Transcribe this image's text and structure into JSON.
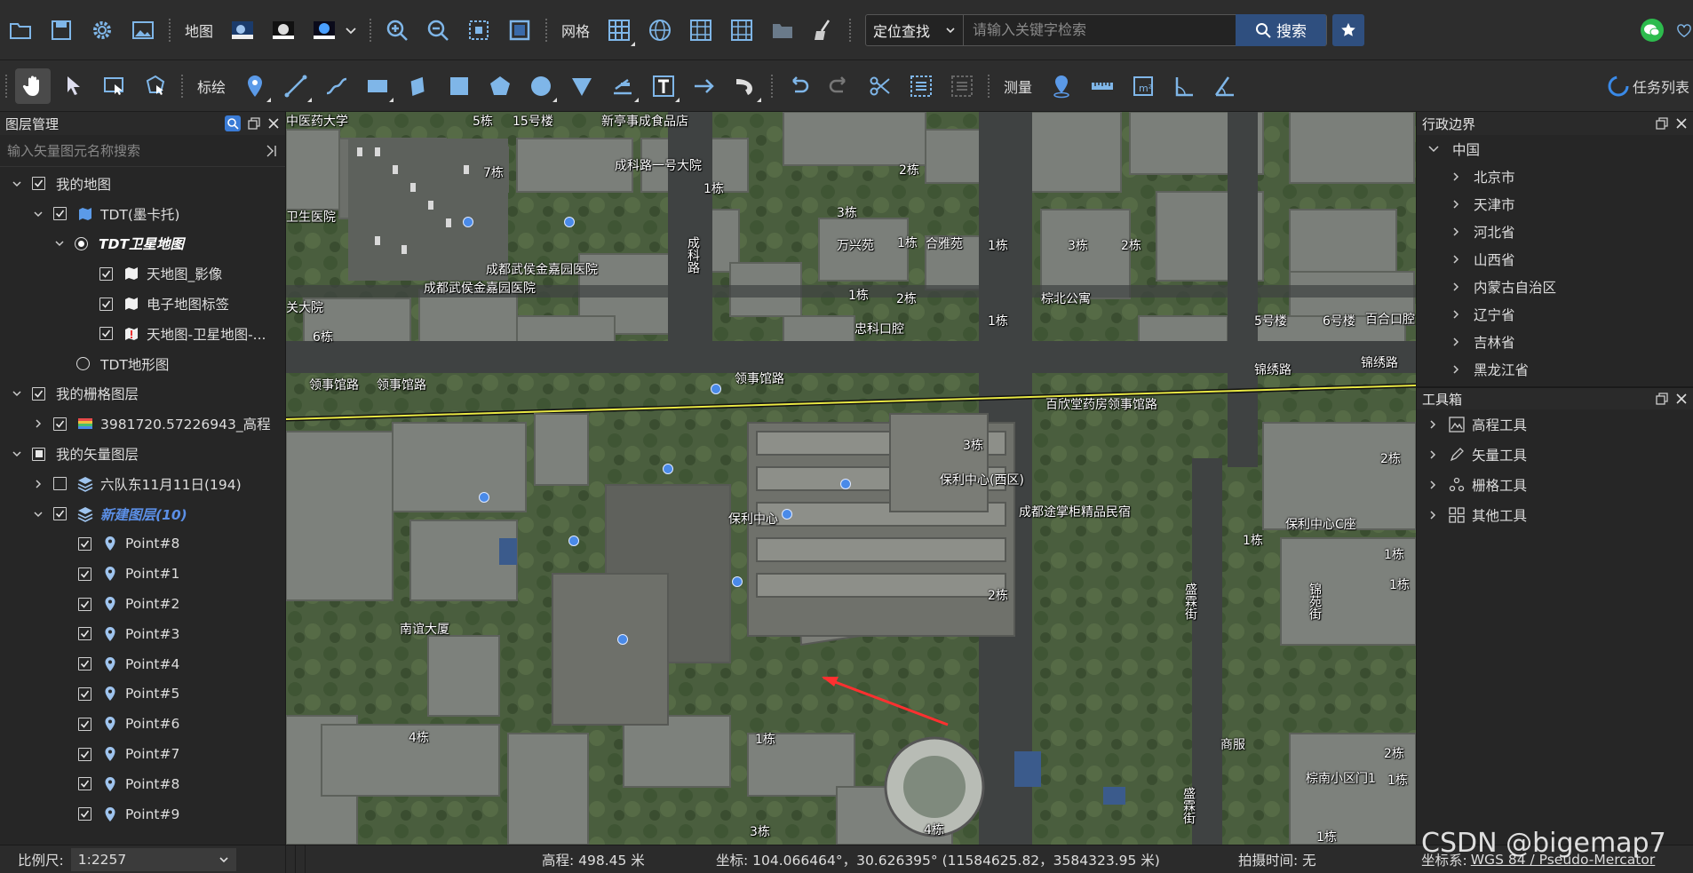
{
  "toolbar1": {
    "map_label": "地图",
    "grid_label": "网格",
    "search_mode": "定位查找",
    "search_placeholder": "请输入关键字检索",
    "search_button": "搜索"
  },
  "toolbar2": {
    "annotate_label": "标绘",
    "measure_label": "测量",
    "task_list": "任务列表"
  },
  "layer_panel": {
    "title": "图层管理",
    "filter_placeholder": "输入矢量图元名称搜索",
    "items": [
      {
        "label": "我的地图"
      },
      {
        "label": "TDT(墨卡托)"
      },
      {
        "label": "TDT卫星地图"
      },
      {
        "label": "天地图_影像"
      },
      {
        "label": "电子地图标签"
      },
      {
        "label": "天地图-卫星地图-..."
      },
      {
        "label": "TDT地形图"
      },
      {
        "label": "我的栅格图层"
      },
      {
        "label": "3981720.57226943_高程"
      },
      {
        "label": "我的矢量图层"
      },
      {
        "label": "六队东11月11日(194)"
      },
      {
        "label": "新建图层(10)"
      },
      {
        "label": "Point#8"
      },
      {
        "label": "Point#1"
      },
      {
        "label": "Point#2"
      },
      {
        "label": "Point#3"
      },
      {
        "label": "Point#4"
      },
      {
        "label": "Point#5"
      },
      {
        "label": "Point#6"
      },
      {
        "label": "Point#7"
      },
      {
        "label": "Point#8"
      },
      {
        "label": "Point#9"
      }
    ]
  },
  "map_labels": [
    "中医药大学",
    "5栋",
    "15号楼",
    "新亭事成食品店",
    "7栋",
    "成科路一号大院",
    "1栋",
    "2栋",
    "卫生医院",
    "3栋",
    "1栋",
    "合雅苑",
    "成科路",
    "万兴苑",
    "1栋",
    "3栋",
    "2栋",
    "成都武侯金嘉园医院",
    "成都武侯金嘉园医院",
    "1栋",
    "2栋",
    "棕北公寓",
    "关大院",
    "6栋",
    "1栋",
    "忠科口腔",
    "5号楼",
    "6号楼",
    "百合口腔",
    "锦绣路",
    "锦绣路",
    "领事馆路",
    "领事馆路",
    "领事馆路",
    "百欣堂药房领事馆路",
    "3栋",
    "2栋",
    "保利中心(西区)",
    "保利中心",
    "成都途掌柜精品民宿",
    "1栋",
    "保利中心C座",
    "1栋",
    "1栋",
    "2栋",
    "南谊大厦",
    "盛霖街",
    "锦苑街",
    "4栋",
    "1栋",
    "商服",
    "2栋",
    "1栋",
    "棕南小区门1",
    "3栋",
    "4栋",
    "1栋",
    "盛霖街"
  ],
  "admin_panel": {
    "title": "行政边界",
    "root": "中国",
    "provinces": [
      "北京市",
      "天津市",
      "河北省",
      "山西省",
      "内蒙古自治区",
      "辽宁省",
      "吉林省",
      "黑龙江省"
    ]
  },
  "toolbox": {
    "title": "工具箱",
    "items": [
      "高程工具",
      "矢量工具",
      "栅格工具",
      "其他工具"
    ]
  },
  "status": {
    "scale_label": "比例尺:",
    "scale_value": "1:2257",
    "elevation": "高程: 498.45 米",
    "coords": "坐标: 104.066464°，30.626395°   (11584625.82，3584323.95 米)",
    "capture_time": "拍摄时间: 无",
    "crs_label": "坐标系:",
    "crs_value": "WGS 84 / Pseudo-Mercator"
  },
  "watermark": "CSDN @bigemap7",
  "colors": {
    "accent": "#2f4f7f",
    "point": "#4a8ae8",
    "link_blue": "#5b8fe6"
  }
}
